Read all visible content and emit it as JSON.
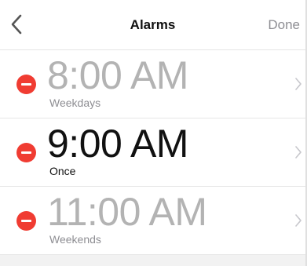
{
  "nav": {
    "title": "Alarms",
    "done_label": "Done",
    "back_icon": "chevron-left-icon"
  },
  "alarms": [
    {
      "time": "8:00 AM",
      "label": "Weekdays",
      "enabled": false
    },
    {
      "time": "9:00 AM",
      "label": "Once",
      "enabled": true
    },
    {
      "time": "11:00 AM",
      "label": "Weekends",
      "enabled": false
    }
  ],
  "colors": {
    "delete": "#f03c32",
    "disabled_text": "#b3b3b3",
    "enabled_text": "#111111",
    "done_text": "#8e8e93"
  }
}
